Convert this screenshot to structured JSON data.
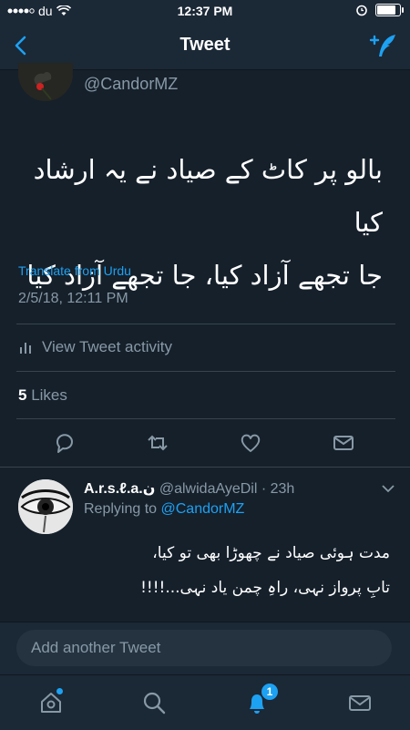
{
  "status_bar": {
    "carrier": "du",
    "time": "12:37 PM",
    "battery_level": 0.9
  },
  "nav": {
    "title": "Tweet"
  },
  "tweet": {
    "handle": "@CandorMZ",
    "text_line1": "بالو پر کاٹ کے صیاد نے یہ ارشاد کیا",
    "text_line2": "جا تجھے آزاد کیا، جا تجھے آزاد کیا",
    "translate_label": "Translate from Urdu",
    "timestamp": "2/5/18, 12:11 PM",
    "activity_label": "View Tweet activity",
    "likes_count": "5",
    "likes_label": "Likes"
  },
  "reply": {
    "name": "A.r.s.ℓ.a.ن",
    "handle": "@alwidaAyeDil",
    "time": "· 23h",
    "replying_prefix": "Replying to",
    "replying_to": "@CandorMZ",
    "text_line1": "مدت ہوئی صیاد نے چھوڑا بھی تو کیا،",
    "text_line2": "تابِ پرواز نہی، راہِ چمن یاد نہی...!!!!"
  },
  "compose": {
    "placeholder": "Add another Tweet"
  },
  "tabs": {
    "notifications_badge": "1"
  },
  "colors": {
    "background": "#15202b",
    "bar": "#1b2836",
    "accent": "#1da1f2",
    "muted": "#8899a6",
    "divider": "#38444d"
  }
}
